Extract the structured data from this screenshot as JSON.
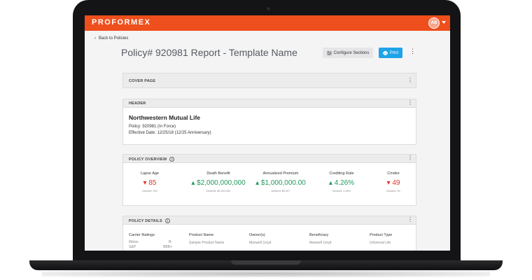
{
  "app": {
    "logo": "PROFORMEX",
    "avatar_initials": "AB"
  },
  "nav": {
    "back_label": "Back to Policies",
    "back_arrow": "‹"
  },
  "page": {
    "title": "Policy# 920981 Report - Template Name"
  },
  "toolbar": {
    "configure_label": "Configure Sections",
    "print_label": "Print",
    "more_icon": "⋮"
  },
  "sections": {
    "cover": {
      "title": "COVER PAGE"
    },
    "header": {
      "title": "HEADER",
      "company": "Northwestern Mutual Life",
      "policy_line": "Policy: 920981 (In Force)",
      "effective_line": "Effective Date: 12/25/18 (12/25 Anniversary)"
    },
    "overview": {
      "title": "POLICY OVERVIEW",
      "info_icon": "i",
      "metrics": [
        {
          "label": "Lapse Age",
          "arrow": "▾",
          "value": "85",
          "desired": "Desired: 100",
          "status": "red"
        },
        {
          "label": "Death Benefit",
          "arrow": "▴",
          "value": "$2,000,000,000",
          "desired": "Desired: $2,000,000",
          "status": "green"
        },
        {
          "label": "Annualized Premium",
          "arrow": "▴",
          "value": "$1,000,000.00",
          "desired": "Desired: $9,027",
          "status": "green"
        },
        {
          "label": "Crediting Rate",
          "arrow": "▴",
          "value": "4.26%",
          "desired": "Desired: 4.26%",
          "status": "green"
        },
        {
          "label": "Cmdex",
          "arrow": "▾",
          "value": "49",
          "desired": "Desired: 50",
          "status": "red"
        }
      ]
    },
    "details": {
      "title": "POLICY DETAILS",
      "info_icon": "i",
      "columns": [
        {
          "header": "Carrier Ratings",
          "value": ""
        },
        {
          "header": "Product Name",
          "value": "Sample Product Name"
        },
        {
          "header": "Owner(s)",
          "value": "Maxwell Lloyd"
        },
        {
          "header": "Beneficiary",
          "value": "Maxwell Lloyd"
        },
        {
          "header": "Product Type",
          "value": "Universal Life"
        }
      ],
      "ratings": [
        {
          "agency": "Weiss",
          "grade": "B-"
        },
        {
          "agency": "S&P",
          "grade": "BBB+"
        }
      ]
    }
  },
  "colors": {
    "brand": "#ee4f1c",
    "print": "#1fa3e8",
    "negative": "#e2332c",
    "positive": "#1f9b5b"
  }
}
